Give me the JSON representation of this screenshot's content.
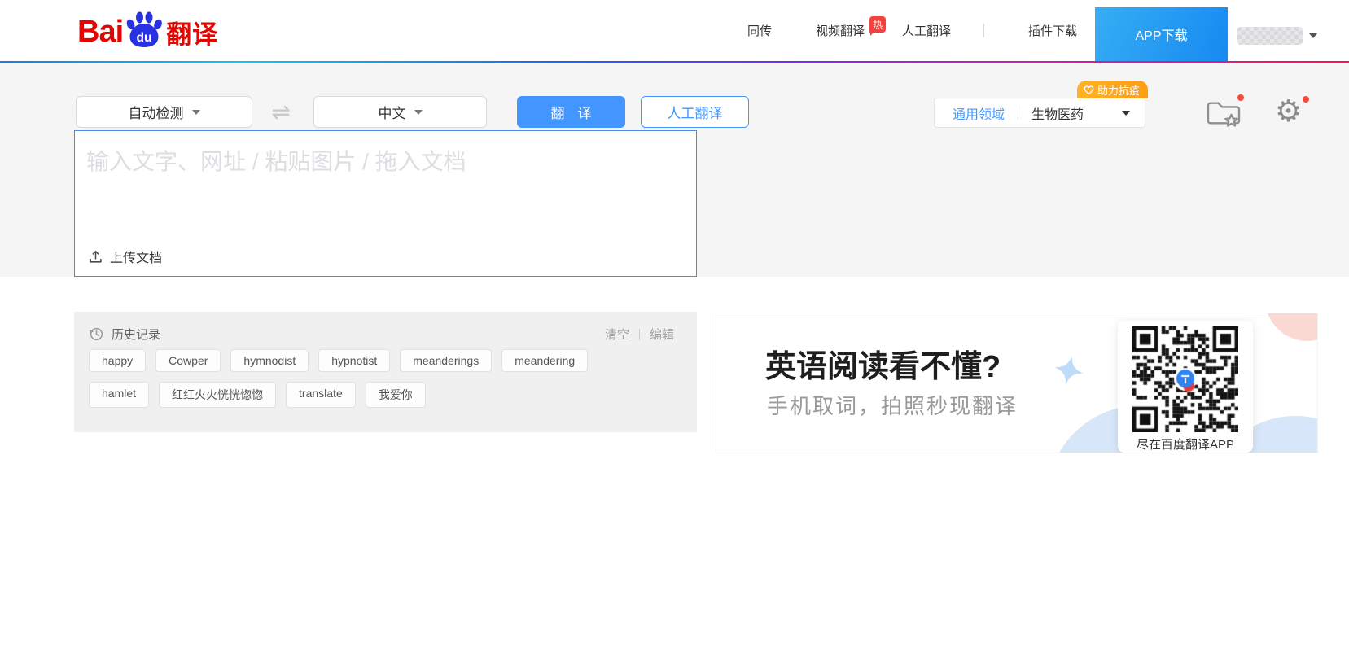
{
  "header": {
    "logo": {
      "bai": "Bai",
      "du": "du",
      "product": "翻译"
    },
    "nav": {
      "simultaneous": "同传",
      "video": "视频翻译",
      "video_hot_badge": "热",
      "human": "人工翻译",
      "plugin": "插件下载",
      "app_download": "APP下载"
    }
  },
  "toolbar": {
    "source_lang": "自动检测",
    "target_lang": "中文",
    "translate_button": "翻译",
    "human_translate_button": "人工翻译",
    "anti_epidemic_badge": "助力抗疫",
    "domain_general": "通用领域",
    "domain_selected": "生物医药"
  },
  "editor": {
    "placeholder": "输入文字、网址 / 粘贴图片 / 拖入文档",
    "upload_doc": "上传文档"
  },
  "history": {
    "title": "历史记录",
    "clear": "清空",
    "edit": "编辑",
    "row1": [
      "happy",
      "Cowper",
      "hymnodist",
      "hypnotist",
      "meanderings",
      "meandering"
    ],
    "row2": [
      "hamlet",
      "红红火火恍恍惚惚",
      "translate",
      "我爱你"
    ]
  },
  "promo": {
    "title": "英语阅读看不懂?",
    "subtitle": "手机取词，拍照秒现翻译",
    "qr_caption": "尽在百度翻译APP"
  },
  "colors": {
    "primary_blue": "#4395ff",
    "badge_orange": "#ffa724",
    "hot_red": "#f3413d",
    "notification_red": "#fa4837",
    "logo_red": "#e10602",
    "logo_blue": "#2932e1"
  }
}
